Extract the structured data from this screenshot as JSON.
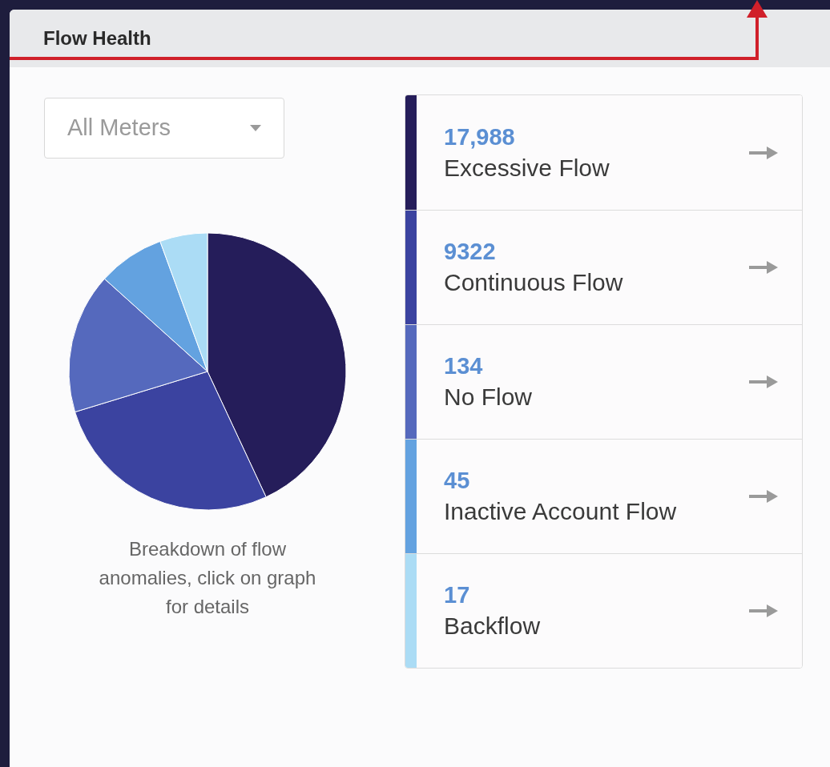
{
  "panel": {
    "title": "Flow Health"
  },
  "filter": {
    "value": "All Meters"
  },
  "caption": "Breakdown of flow anomalies, click on graph for details",
  "categories": [
    {
      "count": "17,988",
      "label": "Excessive Flow",
      "color": "#251d5a"
    },
    {
      "count": "9322",
      "label": "Continuous Flow",
      "color": "#3b43a0"
    },
    {
      "count": "134",
      "label": "No Flow",
      "color": "#5569bd"
    },
    {
      "count": "45",
      "label": "Inactive Account Flow",
      "color": "#63a2e0"
    },
    {
      "count": "17",
      "label": "Backflow",
      "color": "#abdcf5"
    }
  ]
}
